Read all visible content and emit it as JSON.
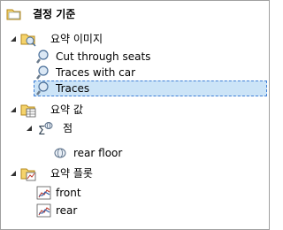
{
  "tree": {
    "root": {
      "label": "결정 기준",
      "icon": "folder-open-icon"
    },
    "images": {
      "label": "요약 이미지",
      "icon": "image-folder-icon",
      "items": [
        {
          "label": "Cut through seats",
          "icon": "magnifier-icon"
        },
        {
          "label": "Traces with car",
          "icon": "magnifier-icon"
        },
        {
          "label": "Traces",
          "icon": "magnifier-icon",
          "selected": true
        }
      ]
    },
    "values": {
      "label": "요약 값",
      "icon": "table-folder-icon",
      "group": {
        "label": "점",
        "icon": "sum-points-icon"
      },
      "items": [
        {
          "label": "rear floor",
          "icon": "point-icon"
        }
      ]
    },
    "plots": {
      "label": "요약 플롯",
      "icon": "plot-folder-icon",
      "items": [
        {
          "label": "front",
          "icon": "line-plot-icon"
        },
        {
          "label": "rear",
          "icon": "line-plot-icon"
        }
      ]
    }
  },
  "colors": {
    "selection_bg": "#cce4f7",
    "selection_border": "#3d7ed6",
    "panel_border": "#a0a0a0",
    "folder_yellow": "#f5d36b"
  }
}
